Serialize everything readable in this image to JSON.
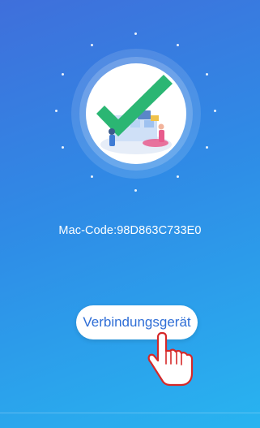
{
  "device": {
    "mac_label": "Mac-Code:98D863C733E0"
  },
  "actions": {
    "connect_label": "Verbindungsgerät"
  },
  "icons": {
    "hero": "success-checkmark-illustration",
    "hint": "pointing-hand-icon"
  },
  "colors": {
    "background_start": "#3f6fdb",
    "background_end": "#28b4f0",
    "check_green": "#2bb673",
    "button_text": "#2f6ed6",
    "hand_outline": "#d62828"
  }
}
